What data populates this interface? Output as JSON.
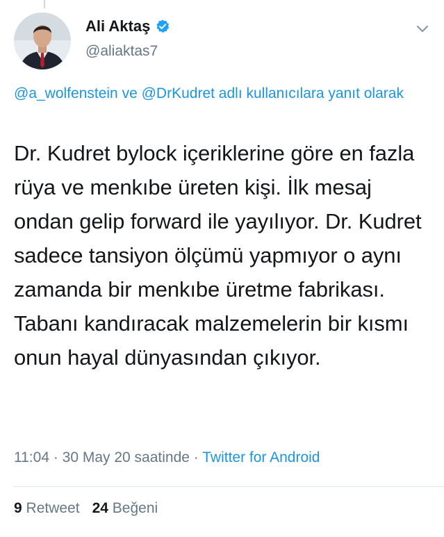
{
  "author": {
    "display_name": "Ali Aktaş",
    "handle": "@aliaktas7",
    "verified": true
  },
  "reply_context": {
    "mention_1": "@a_wolfenstein",
    "connector": " ve ",
    "mention_2": "@DrKudret",
    "suffix": " adlı kullanıcılara yanıt olarak"
  },
  "tweet": {
    "text": "Dr. Kudret bylock içeriklerine göre en fazla rüya ve menkıbe üreten kişi. İlk mesaj ondan gelip forward ile yayılıyor. Dr. Kudret sadece tansiyon ölçümü yapmıyor o aynı zamanda bir menkıbe üretme fabrikası. Tabanı kandıracak malzemelerin bir kısmı onun hayal dünyasından çıkıyor."
  },
  "meta": {
    "time_date": "11:04 · 30 May 20 saatinde · ",
    "source": "Twitter for Android"
  },
  "stats": {
    "retweet_count": "9",
    "retweet_label": "Retweet",
    "like_count": "24",
    "like_label": "Beğeni"
  },
  "icons": {
    "verified": "verified-badge-icon",
    "menu": "chevron-down-icon"
  },
  "colors": {
    "link_blue": "#1b95e0",
    "secondary_gray": "#657786",
    "primary_text": "#14171a"
  }
}
